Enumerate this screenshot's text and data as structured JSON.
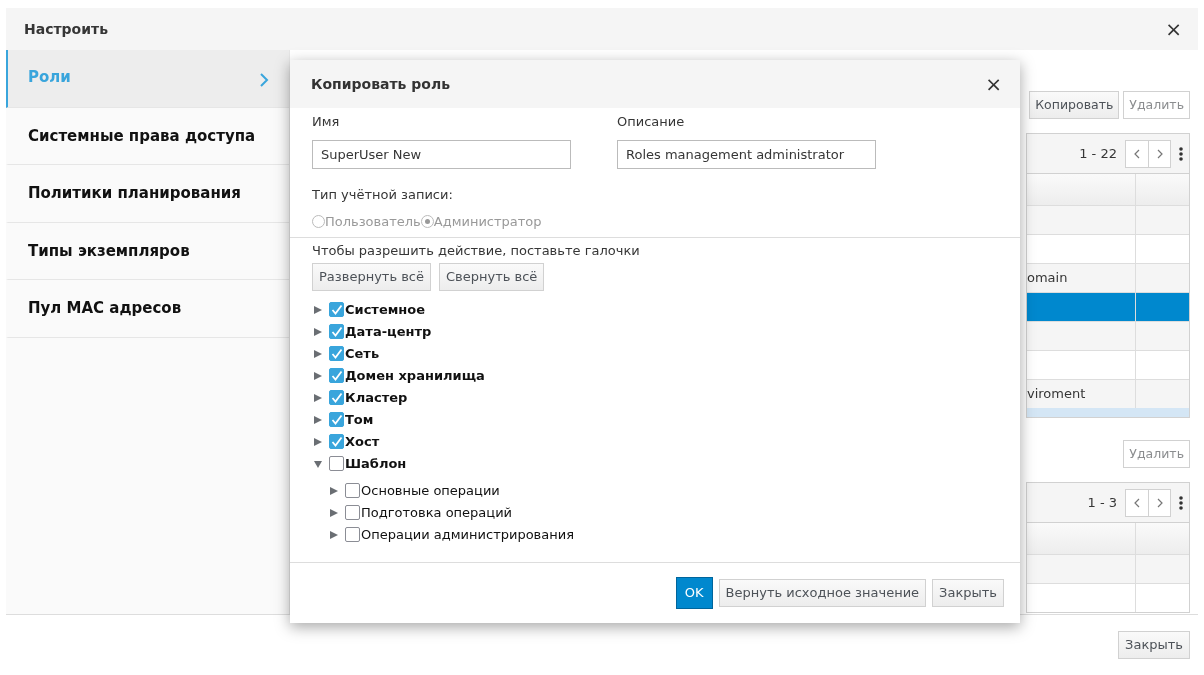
{
  "dialog": {
    "title": "Настроить",
    "close": "×",
    "footer_buttons": [
      "Закрыть"
    ]
  },
  "sidebar": {
    "items": [
      {
        "label": "Роли",
        "selected": true
      },
      {
        "label": "Системные права доступа",
        "selected": false
      },
      {
        "label": "Политики планирования",
        "selected": false
      },
      {
        "label": "Типы экземпляров",
        "selected": false
      },
      {
        "label": "Пул MAC адресов",
        "selected": false
      }
    ]
  },
  "roles_panel": {
    "buttons": [
      "Копировать",
      "Удалить"
    ],
    "pager": "1 - 22",
    "rows": [
      {
        "selected": false
      },
      {
        "selected": false
      },
      {
        "text": "omain",
        "selected": false
      },
      {
        "selected": true
      },
      {
        "selected": false
      },
      {
        "selected": false
      },
      {
        "text": "viroment",
        "selected": false
      }
    ]
  },
  "permissions_panel": {
    "buttons": [
      "Удалить"
    ],
    "pager": "1 - 3",
    "rows": [
      {
        "selected": false
      },
      {
        "selected": false
      }
    ]
  },
  "copy_role_dialog": {
    "title": "Копировать роль",
    "close": "×",
    "fields": [
      {
        "label": "Имя",
        "value": "SuperUser New"
      },
      {
        "label": "Описание",
        "value": "Roles management administrator"
      }
    ],
    "account_type": {
      "label": "Тип учётной записи:",
      "disabled": true,
      "options": [
        {
          "label": "Пользователь",
          "selected": false
        },
        {
          "label": "Администратор",
          "selected": true
        }
      ]
    },
    "hint": "Чтобы разрешить действие, поставьте галочки",
    "tree_buttons": [
      "Развернуть всё",
      "Свернуть всё"
    ],
    "tree": [
      {
        "label": "Системное",
        "checked": true,
        "expanded": false
      },
      {
        "label": "Дата-центр",
        "checked": true,
        "expanded": false
      },
      {
        "label": "Сеть",
        "checked": true,
        "expanded": false
      },
      {
        "label": "Домен хранилища",
        "checked": true,
        "expanded": false
      },
      {
        "label": "Кластер",
        "checked": true,
        "expanded": false
      },
      {
        "label": "Том",
        "checked": true,
        "expanded": false
      },
      {
        "label": "Хост",
        "checked": true,
        "expanded": false
      },
      {
        "label": "Шаблон",
        "checked": false,
        "expanded": true,
        "children": [
          {
            "label": "Основные операции",
            "checked": false,
            "expanded": false
          },
          {
            "label": "Подготовка операций",
            "checked": false,
            "expanded": false
          },
          {
            "label": "Операции администрирования",
            "checked": false,
            "expanded": false
          }
        ]
      }
    ],
    "buttons": [
      {
        "label": "OK",
        "kind": "primary"
      },
      {
        "label": "Вернуть исходное значение",
        "kind": "default"
      },
      {
        "label": "Закрыть",
        "kind": "default"
      }
    ]
  }
}
